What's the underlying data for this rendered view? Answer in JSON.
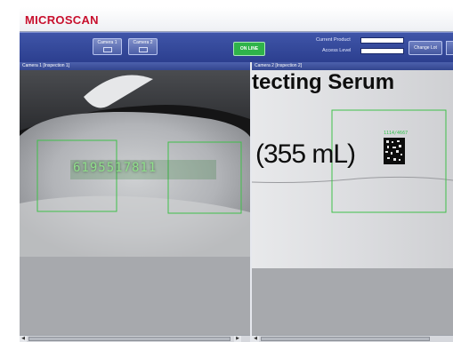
{
  "app": {
    "brand": "MICROSCAN"
  },
  "toolbar": {
    "camera_buttons": [
      {
        "label": "Camera 1"
      },
      {
        "label": "Camera 2"
      }
    ],
    "status": "ON LINE",
    "current_product_label": "Current Product",
    "access_level_label": "Access Level",
    "current_product_value": "",
    "access_level_value": "",
    "change_lot_label": "Change Lot"
  },
  "panels": {
    "left": {
      "title": "Camera 1 [Inspection 1]",
      "decoded_text": "6195517811"
    },
    "right": {
      "title": "Camera 2 [Inspection 2]",
      "image_text_top": "tecting Serum",
      "image_text_mid": "(355 mL)",
      "code_readout": "1114/4667"
    }
  },
  "colors": {
    "brand_red": "#c8102e",
    "toolbar_blue": "#33468f",
    "online_green": "#2fb34a",
    "roi_green": "#3fc04a"
  }
}
